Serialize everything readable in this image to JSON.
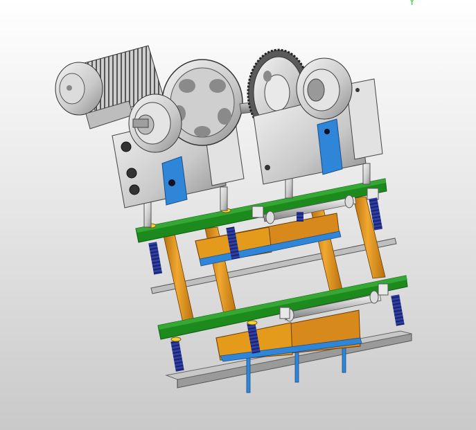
{
  "viewport": {
    "axis_label": "Y",
    "background_top": "#ffffff",
    "background_bottom": "#c9c9c9"
  },
  "model": {
    "colors": {
      "plate_green": "#1c8a1c",
      "plate_green_dark": "#0f5e12",
      "column_orange": "#e49a1a",
      "block_orange": "#d8891c",
      "spring_blue": "#2f3fa6",
      "bracket_blue": "#2f86d8",
      "metal_light": "#e6e6e6",
      "metal_mid": "#b7b7b7",
      "metal_dark": "#6e6e6e"
    }
  }
}
